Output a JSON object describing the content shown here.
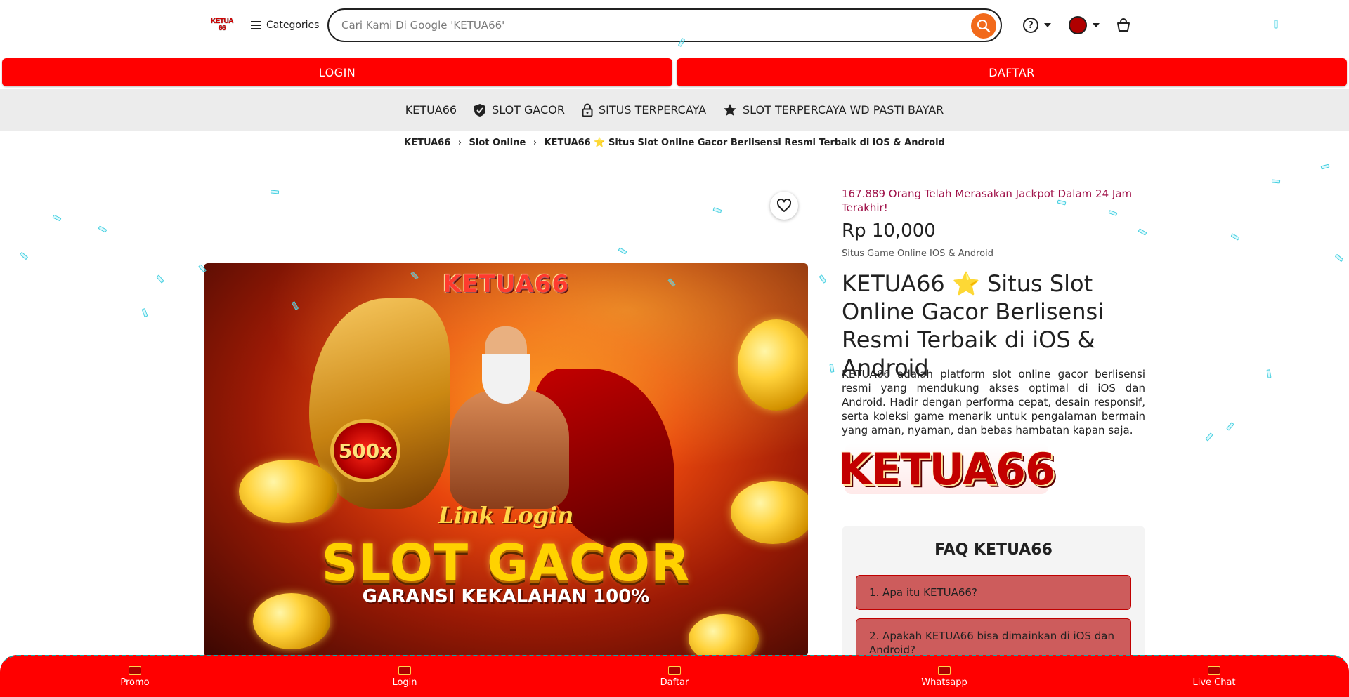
{
  "header": {
    "logo_text": "KETUA 66",
    "categories_label": "Categories",
    "search_placeholder": "Cari Kami Di Google 'KETUA66'"
  },
  "auth": {
    "login_label": "LOGIN",
    "daftar_label": "DAFTAR"
  },
  "tags": [
    {
      "label": "KETUA66",
      "icon": "none"
    },
    {
      "label": "SLOT GACOR",
      "icon": "shield-check-icon"
    },
    {
      "label": "SITUS TERPERCAYA",
      "icon": "lock-icon"
    },
    {
      "label": "SLOT TERPERCAYA WD PASTI BAYAR",
      "icon": "star-icon"
    }
  ],
  "breadcrumb": {
    "items": [
      "KETUA66",
      "Slot Online",
      "KETUA66 ⭐ Situs Slot Online Gacor Berlisensi Resmi Terbaik di iOS & Android"
    ]
  },
  "hero": {
    "brand": "KETUA66",
    "badge": "500x",
    "link_text": "Link Login",
    "headline": "SLOT GACOR",
    "subline": "GARANSI KEKALAHAN 100%"
  },
  "product": {
    "promo_line": "167.889 Orang Telah Merasakan Jackpot Dalam 24 Jam Terakhir!",
    "price": "Rp 10,000",
    "subtitle": "Situs Game Online IOS & Android",
    "title": "KETUA66 ⭐ Situs Slot Online Gacor Berlisensi Resmi Terbaik di iOS & Android",
    "description": "KETUA66 adalah platform slot online gacor berlisensi resmi yang mendukung akses optimal di iOS dan Android. Hadir dengan performa cepat, desain responsif, serta koleksi game menarik untuk pengalaman bermain yang aman, nyaman, dan bebas hambatan kapan saja.",
    "logo_text": "KETUA66"
  },
  "faq": {
    "title": "FAQ KETUA66",
    "items": [
      "1. Apa itu KETUA66?",
      "2. Apakah KETUA66 bisa dimainkan di iOS dan Android?"
    ]
  },
  "bottom_nav": [
    "Promo",
    "Login",
    "Daftar",
    "Whatsapp",
    "Live Chat"
  ],
  "colors": {
    "primary_red": "#ff0000",
    "search_button": "#f26a1b",
    "faq_item": "#cd5c5c",
    "promo_text": "#a0134a",
    "confetti": "#45cfe0"
  }
}
